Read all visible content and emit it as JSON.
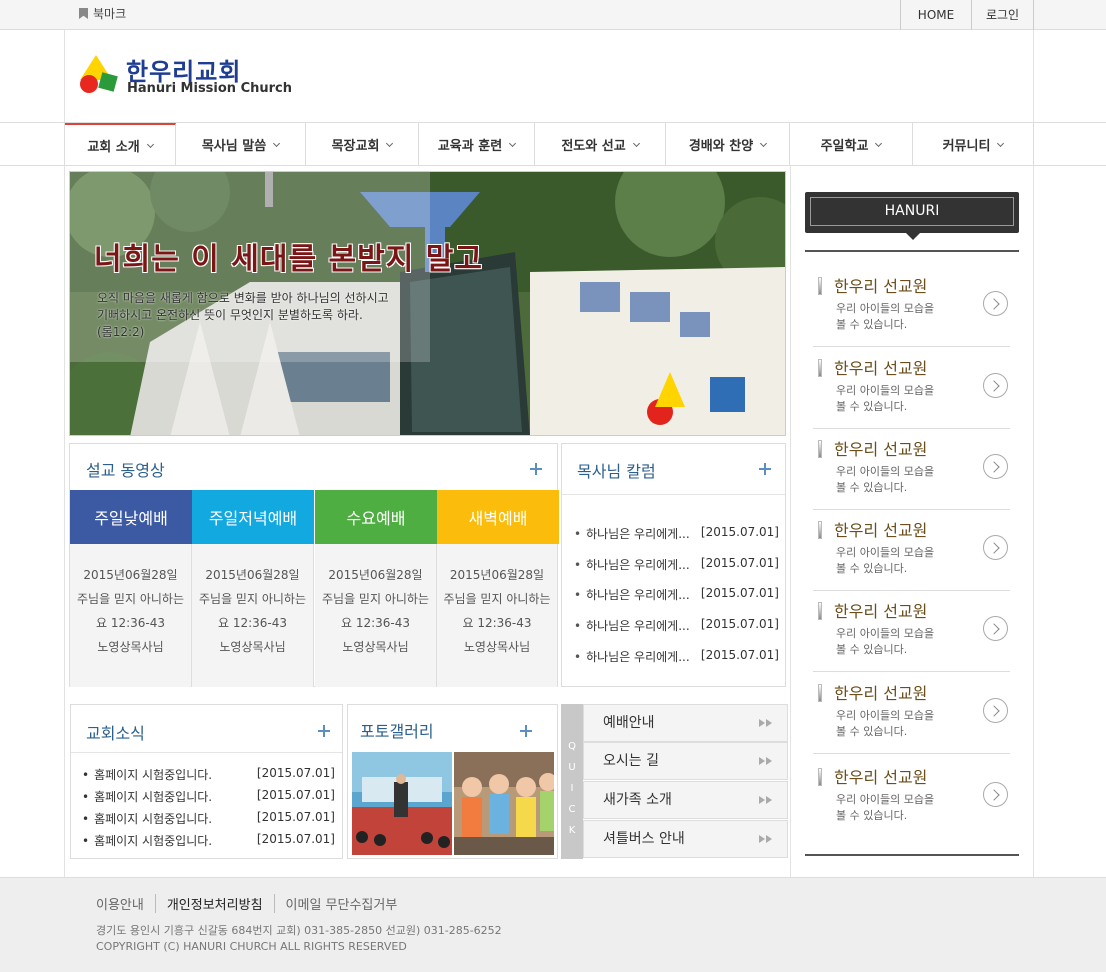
{
  "topbar": {
    "bookmark": "북마크",
    "home": "HOME",
    "login": "로그인"
  },
  "logo": {
    "name_ko": "한우리교회",
    "name_en": "Hanuri Mission Church"
  },
  "nav": [
    {
      "label": "교회 소개"
    },
    {
      "label": "목사님 말씀"
    },
    {
      "label": "목장교회"
    },
    {
      "label": "교육과 훈련"
    },
    {
      "label": "전도와 선교"
    },
    {
      "label": "경배와 찬양"
    },
    {
      "label": "주일학교"
    },
    {
      "label": "커뮤니티"
    }
  ],
  "banner": {
    "title": "너희는 이 세대를 본받지 말고",
    "verse_line1": "오직 마음을 새롭게 함으로 변화를 받아 하나님의 선하시고",
    "verse_line2": "기뻐하시고 온전하신 뜻이 무엇인지 분별하도록 하라.",
    "verse_ref": "(롬12:2)"
  },
  "sermon": {
    "title": "설교 동영상",
    "tabs": [
      {
        "label": "주일낮예배",
        "color": "#3c5aa3",
        "date": "2015년06월28일",
        "title": "주님을 믿지 아니하는",
        "ref": "요 12:36-43",
        "preacher": "노영상목사님"
      },
      {
        "label": "주일저녁예배",
        "color": "#12a8e0",
        "date": "2015년06월28일",
        "title": "주님을 믿지 아니하는",
        "ref": "요 12:36-43",
        "preacher": "노영상목사님"
      },
      {
        "label": "수요예배",
        "color": "#4fae42",
        "date": "2015년06월28일",
        "title": "주님을 믿지 아니하는",
        "ref": "요 12:36-43",
        "preacher": "노영상목사님"
      },
      {
        "label": "새벽예배",
        "color": "#fcbc0c",
        "date": "2015년06월28일",
        "title": "주님을 믿지 아니하는",
        "ref": "요 12:36-43",
        "preacher": "노영상목사님"
      }
    ]
  },
  "column": {
    "title": "목사님 칼럼",
    "items": [
      {
        "text": "하나님은 우리에게...",
        "date": "[2015.07.01]"
      },
      {
        "text": "하나님은 우리에게...",
        "date": "[2015.07.01]"
      },
      {
        "text": "하나님은 우리에게...",
        "date": "[2015.07.01]"
      },
      {
        "text": "하나님은 우리에게...",
        "date": "[2015.07.01]"
      },
      {
        "text": "하나님은 우리에게...",
        "date": "[2015.07.01]"
      }
    ]
  },
  "news": {
    "title": "교회소식",
    "items": [
      {
        "text": "홈페이지 시험중입니다.",
        "date": "[2015.07.01]"
      },
      {
        "text": "홈페이지 시험중입니다.",
        "date": "[2015.07.01]"
      },
      {
        "text": "홈페이지 시험중입니다.",
        "date": "[2015.07.01]"
      },
      {
        "text": "홈페이지 시험중입니다.",
        "date": "[2015.07.01]"
      }
    ]
  },
  "gallery": {
    "title": "포토갤러리"
  },
  "quick": {
    "bar_letters": [
      "Q",
      "U",
      "I",
      "C",
      "K"
    ],
    "items": [
      {
        "label": "예배안내"
      },
      {
        "label": "오시는 길"
      },
      {
        "label": "새가족 소개"
      },
      {
        "label": "셔틀버스 안내"
      }
    ]
  },
  "sidebar": {
    "title": "HANURI",
    "items": [
      {
        "heading": "한우리 선교원",
        "desc_line1": "우리 아이들의 모습을",
        "desc_line2": "볼 수 있습니다."
      },
      {
        "heading": "한우리 선교원",
        "desc_line1": "우리 아이들의 모습을",
        "desc_line2": "볼 수 있습니다."
      },
      {
        "heading": "한우리 선교원",
        "desc_line1": "우리 아이들의 모습을",
        "desc_line2": "볼 수 있습니다."
      },
      {
        "heading": "한우리 선교원",
        "desc_line1": "우리 아이들의 모습을",
        "desc_line2": "볼 수 있습니다."
      },
      {
        "heading": "한우리 선교원",
        "desc_line1": "우리 아이들의 모습을",
        "desc_line2": "볼 수 있습니다."
      },
      {
        "heading": "한우리 선교원",
        "desc_line1": "우리 아이들의 모습을",
        "desc_line2": "볼 수 있습니다."
      },
      {
        "heading": "한우리 선교원",
        "desc_line1": "우리 아이들의 모습을",
        "desc_line2": "볼 수 있습니다."
      }
    ]
  },
  "footer": {
    "links": [
      "이용안내",
      "개인정보처리방침",
      "이메일 무단수집거부"
    ],
    "address": "경기도 용인시 기흥구 신갈동 684번지 교회) 031-385-2850 선교원) 031-285-6252",
    "copyright": "COPYRIGHT (C) HANURI CHURCH ALL RIGHTS RESERVED"
  }
}
